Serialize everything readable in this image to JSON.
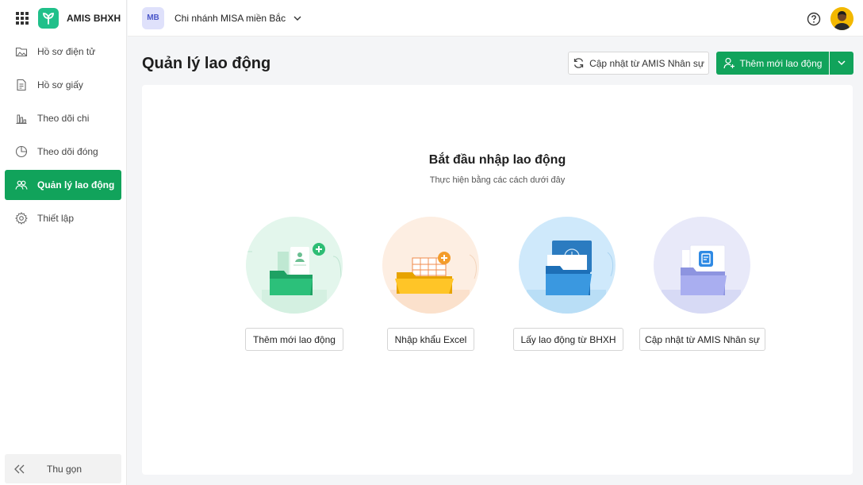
{
  "app": {
    "brand_name": "AMIS BHXH"
  },
  "sidebar": {
    "items": [
      {
        "label": "Hồ sơ điện tử",
        "icon": "folder-icon",
        "active": false
      },
      {
        "label": "Hồ sơ giấy",
        "icon": "document-icon",
        "active": false
      },
      {
        "label": "Theo dõi chi",
        "icon": "bar-chart-icon",
        "active": false
      },
      {
        "label": "Theo dõi đóng",
        "icon": "pie-chart-icon",
        "active": false
      },
      {
        "label": "Quản lý lao động",
        "icon": "users-icon",
        "active": true
      },
      {
        "label": "Thiết lập",
        "icon": "gear-icon",
        "active": false
      }
    ],
    "collapse_label": "Thu gọn"
  },
  "topbar": {
    "branch_initials": "MB",
    "branch_name": "Chi nhánh MISA miền Bắc"
  },
  "header": {
    "title": "Quản lý lao động",
    "sync_button": "Cập nhật từ AMIS Nhân sự",
    "add_button": "Thêm mới lao động"
  },
  "main": {
    "title": "Bắt đầu nhập lao động",
    "subtitle": "Thực hiện bằng các cách dưới đây",
    "options": [
      {
        "label": "Thêm mới lao động"
      },
      {
        "label": "Nhập khẩu Excel"
      },
      {
        "label": "Lấy lao động từ BHXH"
      },
      {
        "label": "Cập nhật từ AMIS Nhân sự"
      }
    ]
  },
  "colors": {
    "primary": "#11a35b",
    "brand_logo": "#20c08a",
    "branch_avatar_bg": "#dfe1fb"
  }
}
